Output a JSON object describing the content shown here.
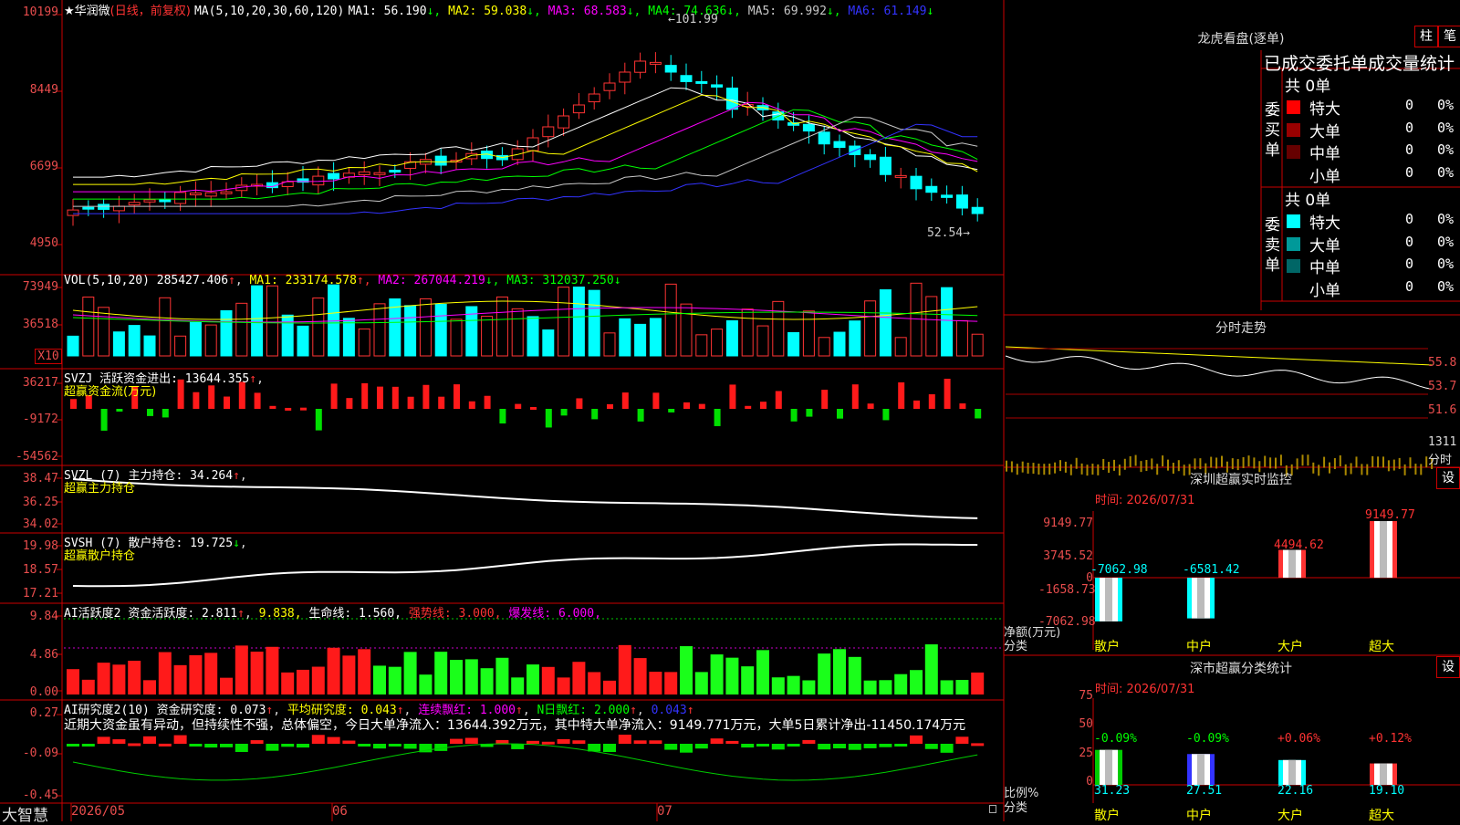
{
  "stock": {
    "star": "★",
    "name": "华润微",
    "mode": "(日线，前复权)"
  },
  "ma_legend": {
    "label": "MA(5,10,20,30,60,120)",
    "items": [
      {
        "name": "MA1:",
        "value": "56.190",
        "arrow": "↓",
        "color": "#ffffff"
      },
      {
        "name": "MA2:",
        "value": "59.038",
        "arrow": "↓",
        "color": "#ffff00"
      },
      {
        "name": "MA3:",
        "value": "68.583",
        "arrow": "↓",
        "color": "#ff00ff"
      },
      {
        "name": "MA4:",
        "value": "74.636",
        "arrow": "↓",
        "color": "#00ff00"
      },
      {
        "name": "MA5:",
        "value": "69.992",
        "arrow": "↓",
        "color": "#c8c8c8"
      },
      {
        "name": "MA6:",
        "value": "61.149",
        "arrow": "↓",
        "color": "#3333ff"
      }
    ]
  },
  "price_axis": [
    "10199",
    "8449",
    "6699",
    "4950"
  ],
  "price_annot": {
    "high": "101.99",
    "low": "52.54"
  },
  "vol": {
    "axis": [
      "73949",
      "36518",
      "X10"
    ],
    "label": "VOL(5,10,20)",
    "value": "285427.406",
    "arrow": "↑",
    "ma": [
      {
        "name": "MA1:",
        "value": "233174.578",
        "arrow": "↑",
        "color": "#ffff00"
      },
      {
        "name": "MA2:",
        "value": "267044.219",
        "arrow": "↓",
        "color": "#ff00ff"
      },
      {
        "name": "MA3:",
        "value": "312037.250",
        "arrow": "↓",
        "color": "#00ff00"
      }
    ]
  },
  "svzj": {
    "axis": [
      "36217",
      "-9172",
      "-54562"
    ],
    "label": "SVZJ",
    "desc": "活跃资金进出:",
    "value": "13644.355",
    "arrow": "↑",
    "sub": "超赢资金流(万元)"
  },
  "svzl": {
    "axis": [
      "38.47",
      "36.25",
      "34.02"
    ],
    "label": "SVZL (7)",
    "desc": "主力持仓:",
    "value": "34.264",
    "arrow": "↑",
    "sub": "超赢主力持仓"
  },
  "svsh": {
    "axis": [
      "19.98",
      "18.57",
      "17.21"
    ],
    "label": "SVSH (7)",
    "desc": "散户持仓:",
    "value": "19.725",
    "arrow": "↓",
    "sub": "超赢散户持仓"
  },
  "ai1": {
    "axis": [
      "9.84",
      "4.86",
      "0.00"
    ],
    "label": "AI活跃度2",
    "desc": "资金活跃度:",
    "value": "2.811",
    "arrow": "↑",
    "v2": "9.838,",
    "l3": "生命线:",
    "v3": "1.560,",
    "l4": "强势线:",
    "v4": "3.000,",
    "l5": "爆发线:",
    "v5": "6.000,"
  },
  "ai2": {
    "axis": [
      "0.27",
      "-0.09",
      "-0.45"
    ],
    "label": "AI研究度2(10)",
    "desc": "资金研究度:",
    "value": "0.073",
    "arrow": "↑",
    "l2": "平均研究度:",
    "v2": "0.043",
    "a2": "↑",
    "l3": "连续飘红:",
    "v3": "1.000",
    "a3": "↑",
    "l4": "N日飘红:",
    "v4": "2.000",
    "a4": "↑",
    "v5": "0.043",
    "a5": "↑",
    "comment": "近期大资金虽有异动，但持续性不强，总体偏空，今日大单净流入：13644.392万元，其中特大单净流入：9149.771万元，大单5日累计净出-11450.174万元"
  },
  "bottom": {
    "brand": "大智慧",
    "dates": [
      "2026/05",
      "06",
      "07"
    ]
  },
  "lhb": {
    "title": "龙虎看盘(逐单)",
    "btn1": "柱",
    "btn2": "笔",
    "header": "已成交委托单成交量统计",
    "buy": {
      "side": "委买单",
      "total": "共 0单",
      "rows": [
        {
          "label": "特大",
          "n": "0",
          "pct": "0%",
          "color": "#ff0000"
        },
        {
          "label": "大单",
          "n": "0",
          "pct": "0%",
          "color": "#990000"
        },
        {
          "label": "中单",
          "n": "0",
          "pct": "0%",
          "color": "#660000"
        },
        {
          "label": "小单",
          "n": "0",
          "pct": "0%",
          "color": "#000000"
        }
      ]
    },
    "sell": {
      "side": "委卖单",
      "total": "共 0单",
      "rows": [
        {
          "label": "特大",
          "n": "0",
          "pct": "0%",
          "color": "#00ffff"
        },
        {
          "label": "大单",
          "n": "0",
          "pct": "0%",
          "color": "#009999"
        },
        {
          "label": "中单",
          "n": "0",
          "pct": "0%",
          "color": "#006666"
        },
        {
          "label": "小单",
          "n": "0",
          "pct": "0%",
          "color": "#000000"
        }
      ]
    }
  },
  "fenshi": {
    "title": "分时走势",
    "axis": [
      "55.8",
      "53.7",
      "51.6",
      "1311",
      "分时"
    ]
  },
  "monitor": {
    "title": "深圳超赢实时监控",
    "btn": "设",
    "time": "时间: 2026/07/31",
    "axis": [
      "9149.77",
      "3745.52",
      "0",
      "-1658.73",
      "-7062.98"
    ],
    "ylab1": "净额(万元)",
    "ylab2": "分类",
    "bars": [
      {
        "label": "散户",
        "value": "-7062.98"
      },
      {
        "label": "中户",
        "value": "-6581.42"
      },
      {
        "label": "大户",
        "value": "4494.62"
      },
      {
        "label": "超大",
        "value": "9149.77"
      }
    ]
  },
  "classify": {
    "title": "深市超赢分类统计",
    "btn": "设",
    "time": "时间: 2026/07/31",
    "axis": [
      "75",
      "50",
      "25",
      "0"
    ],
    "ylab1": "比例%",
    "ylab2": "分类",
    "bars": [
      {
        "label": "散户",
        "pct": "31.23",
        "chg": "-0.09%"
      },
      {
        "label": "中户",
        "pct": "27.51",
        "chg": "-0.09%"
      },
      {
        "label": "大户",
        "pct": "22.16",
        "chg": "+0.06%"
      },
      {
        "label": "超大",
        "pct": "19.10",
        "chg": "+0.12%"
      }
    ]
  }
}
